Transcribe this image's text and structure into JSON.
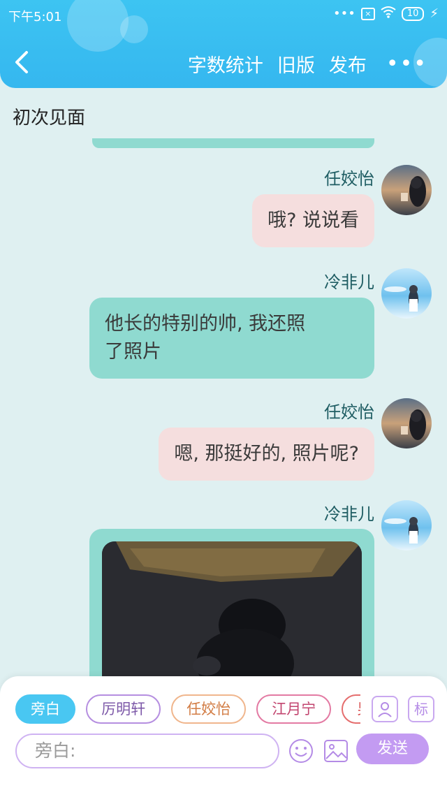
{
  "status_bar": {
    "time": "下午5:01",
    "signal": "•••",
    "battery": "10"
  },
  "header": {
    "actions": [
      "字数统计",
      "旧版",
      "发布"
    ],
    "more": "•••"
  },
  "chat": {
    "title": "初次见面",
    "messages": [
      {
        "speaker": "任姣怡",
        "text": "哦? 说说看",
        "style": "pink"
      },
      {
        "speaker": "冷非儿",
        "text_line1": "他长的特别的帅, 我还照",
        "text_line2": "了照片",
        "style": "teal"
      },
      {
        "speaker": "任姣怡",
        "text": "嗯, 那挺好的, 照片呢?",
        "style": "pink"
      },
      {
        "speaker": "冷非儿",
        "type": "image"
      }
    ]
  },
  "composer": {
    "roles": [
      "旁白",
      "厉明轩",
      "任姣怡",
      "江月宁",
      "男主"
    ],
    "active_role": "旁白",
    "role_btn": "",
    "mark_btn": "标",
    "placeholder": "旁白:",
    "send_label": "发送"
  },
  "colors": {
    "header": "#3dc4f2",
    "teal_bubble": "#8fdad0",
    "pink_bubble": "#f5dede",
    "send": "#c39bf2"
  }
}
